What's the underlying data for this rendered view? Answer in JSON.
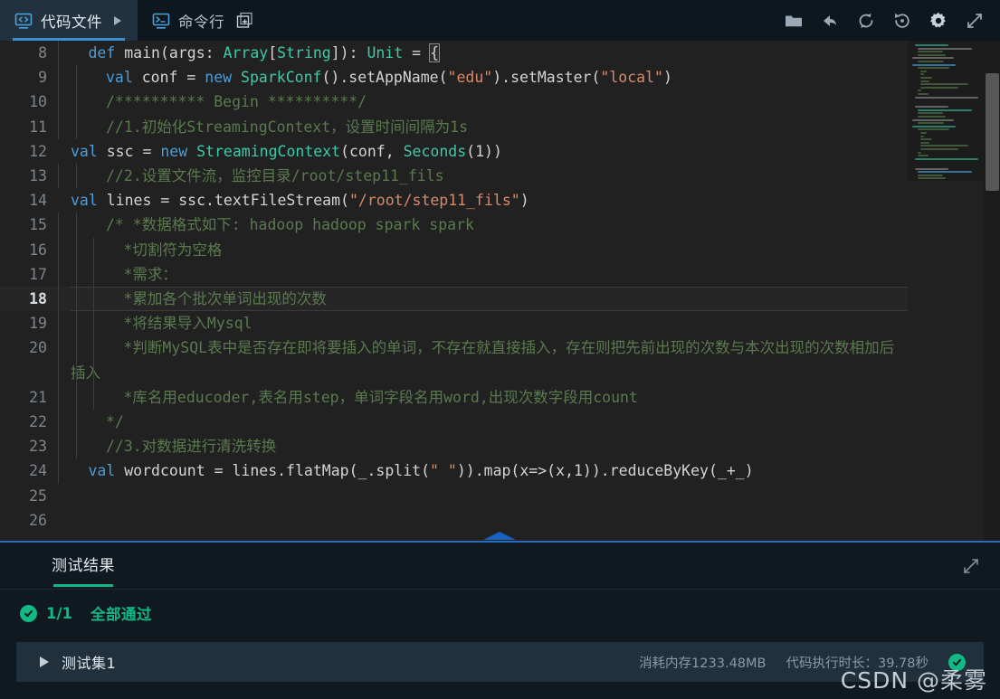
{
  "topbar": {
    "tabs": [
      {
        "label": "代码文件",
        "icon": "code-file-icon",
        "active": true,
        "caret": true
      },
      {
        "label": "命令行",
        "icon": "terminal-icon",
        "active": false,
        "add": true
      }
    ],
    "toolbar": [
      {
        "name": "folder-icon",
        "title": "文件"
      },
      {
        "name": "undo-icon",
        "title": "撤销"
      },
      {
        "name": "refresh-icon",
        "title": "刷新"
      },
      {
        "name": "history-icon",
        "title": "历史"
      },
      {
        "name": "gear-icon",
        "title": "设置"
      },
      {
        "name": "expand-icon",
        "title": "全屏"
      }
    ]
  },
  "editor": {
    "background": "#212121",
    "active_line": 18,
    "lines": [
      {
        "n": "8",
        "indent": 1,
        "html": "<span class=\"kw\">def</span> <span class=\"pl\">main(args: </span><span class=\"typ\">Array</span><span class=\"pl\">[</span><span class=\"typ\">String</span><span class=\"pl\">]): </span><span class=\"typ\">Unit</span><span class=\"pl\"> = </span><span class=\"brk\">{</span>",
        "text": "def main(args: Array[String]): Unit = {"
      },
      {
        "n": "9",
        "indent": 2,
        "html": "<span class=\"kw\">val</span> <span class=\"pl\">conf = </span><span class=\"kw\">new</span> <span class=\"typ\">SparkConf</span><span class=\"pl\">().setAppName(</span><span class=\"str\">\"edu\"</span><span class=\"pl\">).setMaster(</span><span class=\"str\">\"local\"</span><span class=\"pl\">)</span>",
        "text": "val conf = new SparkConf().setAppName(\"edu\").setMaster(\"local\")"
      },
      {
        "n": "10",
        "indent": 2,
        "html": "<span class=\"cmt\">/********** Begin **********/</span>",
        "text": "/********** Begin **********/"
      },
      {
        "n": "11",
        "indent": 2,
        "html": "<span class=\"cmt\">//1.初始化StreamingContext，设置时间间隔为1s</span>",
        "text": "//1.初始化StreamingContext，设置时间间隔为1s"
      },
      {
        "n": "12",
        "indent": 0,
        "html": "<span class=\"kw\">val</span> <span class=\"pl\">ssc = </span><span class=\"kw\">new</span> <span class=\"typ\">StreamingContext</span><span class=\"pl\">(conf, </span><span class=\"typ\">Seconds</span><span class=\"pl\">(1))</span>",
        "text": "val ssc = new StreamingContext(conf, Seconds(1))"
      },
      {
        "n": "13",
        "indent": 2,
        "html": "<span class=\"cmt\">//2.设置文件流，监控目录/root/step11_fils</span>",
        "text": "//2.设置文件流，监控目录/root/step11_fils"
      },
      {
        "n": "14",
        "indent": 0,
        "html": "<span class=\"kw\">val</span> <span class=\"pl\">lines = ssc.textFileStream(</span><span class=\"str\">\"/root/step11_fils\"</span><span class=\"pl\">)</span>",
        "text": "val lines = ssc.textFileStream(\"/root/step11_fils\")"
      },
      {
        "n": "15",
        "indent": 2,
        "html": "<span class=\"cmt\">/* *数据格式如下: hadoop hadoop spark spark</span>",
        "text": "/* *数据格式如下: hadoop hadoop spark spark"
      },
      {
        "n": "16",
        "indent": 3,
        "html": "<span class=\"cmt\">*切割符为空格</span>",
        "text": "*切割符为空格"
      },
      {
        "n": "17",
        "indent": 3,
        "html": "<span class=\"cmt\">*需求：</span>",
        "text": "*需求："
      },
      {
        "n": "18",
        "indent": 3,
        "html": "<span class=\"cmt\">*累加各个批次单词出现的次数</span>",
        "text": "*累加各个批次单词出现的次数"
      },
      {
        "n": "19",
        "indent": 3,
        "html": "<span class=\"cmt\">*将结果导入Mysql</span>",
        "text": "*将结果导入Mysql"
      },
      {
        "n": "20",
        "indent": 3,
        "html": "<span class=\"cmt\">*判断MySQL表中是否存在即将要插入的单词，不存在就直接插入，存在则把先前出现的次数与本次出现的次数相加后插入</span>",
        "text": "*判断MySQL表中是否存在即将要插入的单词，不存在就直接插入，存在则把先前出现的次数与本次出现的次数相加后插入"
      },
      {
        "n": "21",
        "indent": 3,
        "html": "<span class=\"cmt\">*库名用educoder,表名用step，单词字段名用word,出现次数字段用count</span>",
        "text": "*库名用educoder,表名用step，单词字段名用word,出现次数字段用count"
      },
      {
        "n": "22",
        "indent": 2,
        "html": "<span class=\"cmt\">*/</span>",
        "text": "*/"
      },
      {
        "n": "23",
        "indent": 2,
        "html": "<span class=\"cmt\">//3.对数据进行清洗转换</span>",
        "text": "//3.对数据进行清洗转换"
      },
      {
        "n": "24",
        "indent": 1,
        "html": "<span class=\"kw\">val</span> <span class=\"pl\">wordcount = lines.flatMap(_.split(</span><span class=\"str\">\" \"</span><span class=\"pl\">)).map(x=&gt;(x,1)).reduceByKey(_+_)</span>",
        "text": "val wordcount = lines.flatMap(_.split(\" \")).map(x=>(x,1)).reduceByKey(_+_)"
      },
      {
        "n": "25",
        "indent": 0,
        "html": "",
        "text": ""
      },
      {
        "n": "26",
        "indent": 0,
        "html": "",
        "text": ""
      }
    ]
  },
  "bottom": {
    "tabs": [
      {
        "label": "测试结果",
        "active": true
      }
    ],
    "expand_icon": "expand-icon",
    "summary": {
      "count": "1/1",
      "status_text": "全部通过",
      "status_color": "#12b886",
      "icon": "check-circle-icon"
    },
    "case": {
      "name": "测试集1",
      "memory": "消耗内存1233.48MB",
      "duration": "代码执行时长：39.78秒",
      "status_icon": "check-circle-icon"
    }
  },
  "watermark": {
    "text": "CSDN @柔雾"
  }
}
